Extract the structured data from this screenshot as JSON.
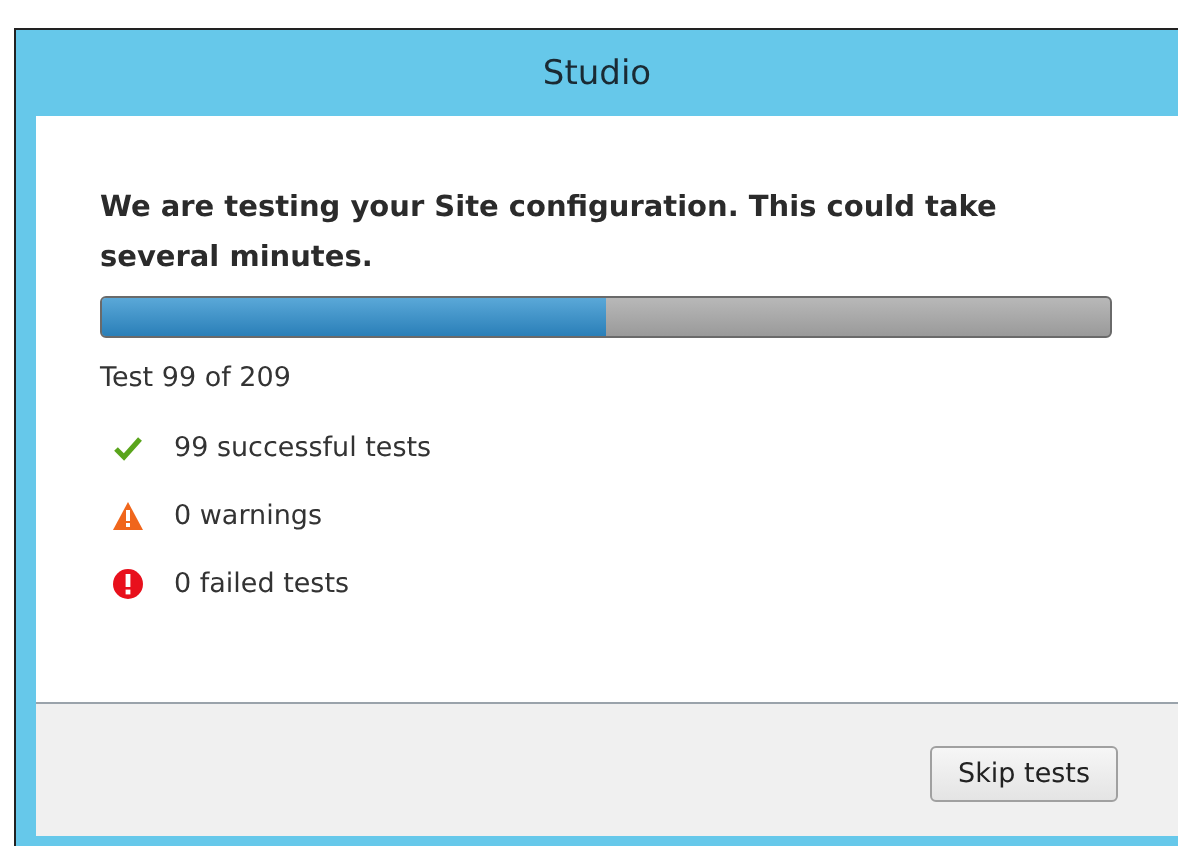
{
  "window": {
    "title": "Studio"
  },
  "message": "We are testing your Site configuration. This could take several minutes.",
  "progress": {
    "level": 0.5,
    "caption": "Test 99 of 209"
  },
  "results": [
    {
      "kind": "success",
      "label": "99 successful tests"
    },
    {
      "kind": "warning",
      "label": "0 warnings"
    },
    {
      "kind": "error",
      "label": "0 failed tests"
    }
  ],
  "buttons": [
    "Skip tests"
  ]
}
